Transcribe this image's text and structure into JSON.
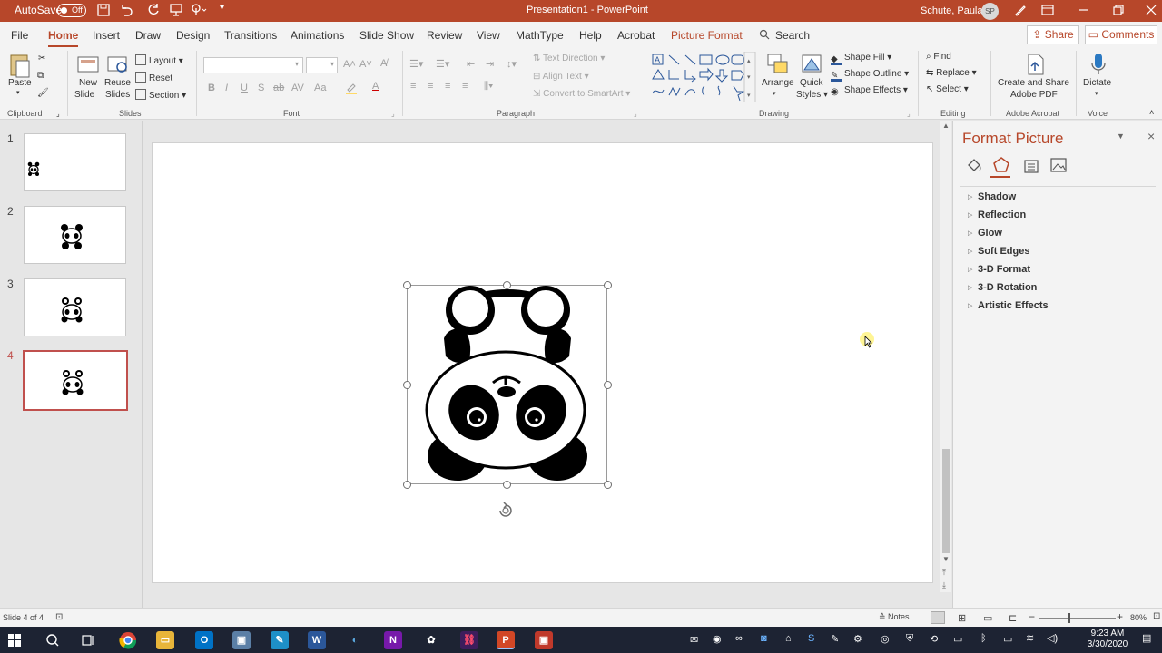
{
  "titlebar": {
    "autosave_label": "AutoSave",
    "autosave_state": "Off",
    "doc_title": "Presentation1  -  PowerPoint",
    "user_name": "Schute, Paula",
    "user_initials": "SP",
    "accent": "#b7472a"
  },
  "tabs": [
    "File",
    "Home",
    "Insert",
    "Draw",
    "Design",
    "Transitions",
    "Animations",
    "Slide Show",
    "Review",
    "View",
    "MathType",
    "Help",
    "Acrobat",
    "Picture Format"
  ],
  "search_label": "Search",
  "share_label": "Share",
  "comments_label": "Comments",
  "ribbon": {
    "clipboard": {
      "paste": "Paste",
      "group": "Clipboard"
    },
    "slides": {
      "new_slide_1": "New",
      "new_slide_2": "Slide",
      "reuse_1": "Reuse",
      "reuse_2": "Slides",
      "layout": "Layout",
      "reset": "Reset",
      "section": "Section",
      "group": "Slides"
    },
    "font": {
      "group": "Font"
    },
    "paragraph": {
      "text_direction": "Text Direction",
      "align_text": "Align Text",
      "convert_smartart": "Convert to SmartArt",
      "group": "Paragraph"
    },
    "drawing": {
      "arrange": "Arrange",
      "quick_1": "Quick",
      "quick_2": "Styles",
      "shape_fill": "Shape Fill",
      "shape_outline": "Shape Outline",
      "shape_effects": "Shape Effects",
      "group": "Drawing"
    },
    "editing": {
      "find": "Find",
      "replace": "Replace",
      "select": "Select",
      "group": "Editing"
    },
    "acrobat": {
      "label_1": "Create and Share",
      "label_2": "Adobe PDF",
      "group": "Adobe Acrobat"
    },
    "voice": {
      "dictate": "Dictate",
      "group": "Voice"
    }
  },
  "slides": [
    {
      "number": "1"
    },
    {
      "number": "2"
    },
    {
      "number": "3"
    },
    {
      "number": "4"
    }
  ],
  "format_pane": {
    "title": "Format Picture",
    "items": [
      "Shadow",
      "Reflection",
      "Glow",
      "Soft Edges",
      "3-D Format",
      "3-D Rotation",
      "Artistic Effects"
    ]
  },
  "status": {
    "slide_info": "Slide 4 of 4",
    "notes": "Notes",
    "zoom": "80%"
  },
  "taskbar": {
    "time": "9:23 AM",
    "date": "3/30/2020"
  }
}
